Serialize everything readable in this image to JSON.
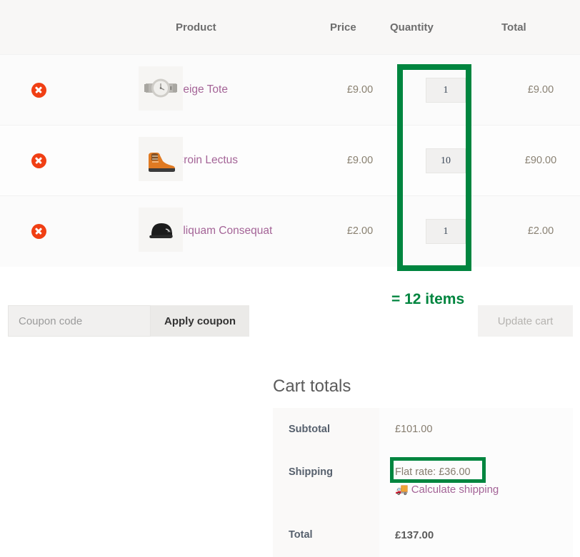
{
  "cart": {
    "headers": {
      "remove": "",
      "thumbnail": "",
      "product": "Product",
      "price": "Price",
      "quantity": "Quantity",
      "total": "Total"
    },
    "items": [
      {
        "remove_label": "Remove this item",
        "thumb_name": "watch-thumbnail",
        "name": "Beige Tote",
        "price": "£9.00",
        "quantity": "1",
        "line_total": "£9.00"
      },
      {
        "remove_label": "Remove this item",
        "thumb_name": "boots-thumbnail",
        "name": "Croin Lectus",
        "price": "£9.00",
        "quantity": "10",
        "line_total": "£90.00"
      },
      {
        "remove_label": "Remove this item",
        "thumb_name": "cap-thumbnail",
        "name": "Aliquam Consequat",
        "price": "£2.00",
        "quantity": "1",
        "line_total": "£2.00"
      }
    ],
    "coupon": {
      "placeholder": "Coupon code",
      "value": "",
      "apply_label": "Apply coupon"
    },
    "update_cart_label": "Update cart"
  },
  "annotations": {
    "items_sum": "= 12 items",
    "quantity_box_color": "#00853f",
    "shipping_box_color": "#00853f"
  },
  "totals": {
    "title": "Cart totals",
    "rows": [
      {
        "label": "Subtotal",
        "value": "£101.00"
      },
      {
        "label": "Total",
        "value": "£137.00"
      }
    ],
    "shipping": {
      "label": "Shipping",
      "rate": "Flat rate: £36.00",
      "calculate_link": "Calculate shipping",
      "truck_icon": "🚚"
    }
  },
  "colors": {
    "link": "#a46497",
    "remove": "#f03f14",
    "annotation_green": "#00853f"
  }
}
